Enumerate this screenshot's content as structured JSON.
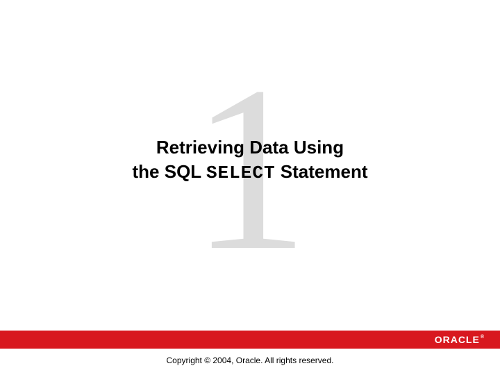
{
  "watermark": "1",
  "title": {
    "line1": "Retrieving Data Using",
    "line2_prefix": "the SQL ",
    "line2_mono": "SELECT",
    "line2_suffix": " Statement"
  },
  "footer": {
    "logo_text": "ORACLE",
    "logo_reg": "®",
    "copyright": "Copyright © 2004, Oracle.  All rights reserved."
  }
}
